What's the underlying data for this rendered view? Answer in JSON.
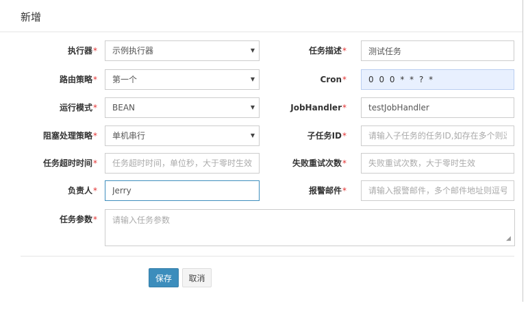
{
  "title": "新增",
  "fields": {
    "executor": {
      "label": "执行器",
      "required": "*",
      "value": "示例执行器"
    },
    "route": {
      "label": "路由策略",
      "required": "*",
      "value": "第一个"
    },
    "mode": {
      "label": "运行模式",
      "required": "*",
      "value": "BEAN"
    },
    "block": {
      "label": "阻塞处理策略",
      "required": "*",
      "value": "单机串行"
    },
    "timeout": {
      "label": "任务超时时间",
      "required": "*",
      "value": "",
      "placeholder": "任务超时时间，单位秒，大于零时生效"
    },
    "author": {
      "label": "负责人",
      "required": "*",
      "value": "Jerry"
    },
    "param": {
      "label": "任务参数",
      "required": "*",
      "value": "",
      "placeholder": "请输入任务参数"
    },
    "desc": {
      "label": "任务描述",
      "required": "*",
      "value": "测试任务"
    },
    "cron": {
      "label": "Cron",
      "required": "*",
      "value": "0 0 0 * * ? *"
    },
    "handler": {
      "label": "JobHandler",
      "required": "*",
      "value": "testJobHandler"
    },
    "child": {
      "label": "子任务ID",
      "required": "*",
      "value": "",
      "placeholder": "请输入子任务的任务ID,如存在多个则逗号分隔"
    },
    "retry": {
      "label": "失败重试次数",
      "required": "*",
      "value": "",
      "placeholder": "失败重试次数，大于零时生效"
    },
    "alarm": {
      "label": "报警邮件",
      "required": "*",
      "value": "",
      "placeholder": "请输入报警邮件，多个邮件地址则逗号分隔"
    }
  },
  "buttons": {
    "save": "保存",
    "cancel": "取消"
  },
  "icons": {
    "select_arrow": "caret-down-icon",
    "resize_grip": "resize-grip-icon"
  },
  "colors": {
    "primary": "#3c8dbc",
    "required_star": "#e23131",
    "cron_bg": "#e8f0fe"
  }
}
